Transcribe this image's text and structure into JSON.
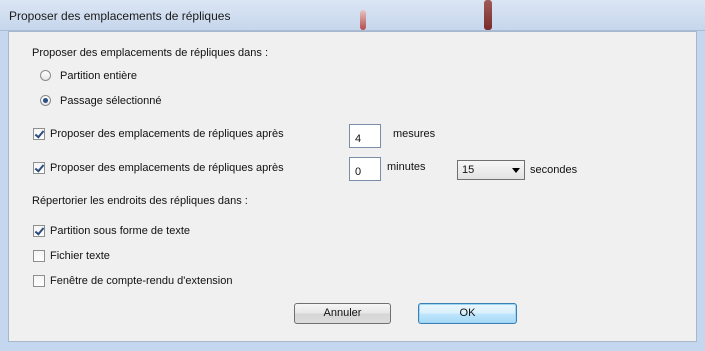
{
  "window": {
    "title": "Proposer des emplacements de répliques"
  },
  "section1": {
    "heading": "Proposer des emplacements de répliques dans :",
    "radio_entire": "Partition entière",
    "radio_selected": "Passage sélectionné",
    "selected_option": "radio_selected"
  },
  "measures_row": {
    "label": "Proposer des emplacements de répliques après",
    "checked": true,
    "value": "4",
    "unit": "mesures"
  },
  "time_row": {
    "label": "Proposer des emplacements de répliques après",
    "checked": true,
    "minutes_value": "0",
    "minutes_unit": "minutes",
    "seconds_value": "15",
    "seconds_unit": "secondes"
  },
  "section2": {
    "heading": "Répertorier les endroits des répliques dans :",
    "opt_score_text": "Partition sous forme de texte",
    "opt_text_file": "Fichier texte",
    "opt_plugin_window": "Fenêtre de compte-rendu d'extension",
    "score_text_checked": true,
    "text_file_checked": false,
    "plugin_window_checked": false
  },
  "buttons": {
    "cancel": "Annuler",
    "ok": "OK"
  },
  "colors": {
    "frame": "#c5d7ee",
    "client": "#f0f0f0",
    "check": "#2b4c7e"
  }
}
